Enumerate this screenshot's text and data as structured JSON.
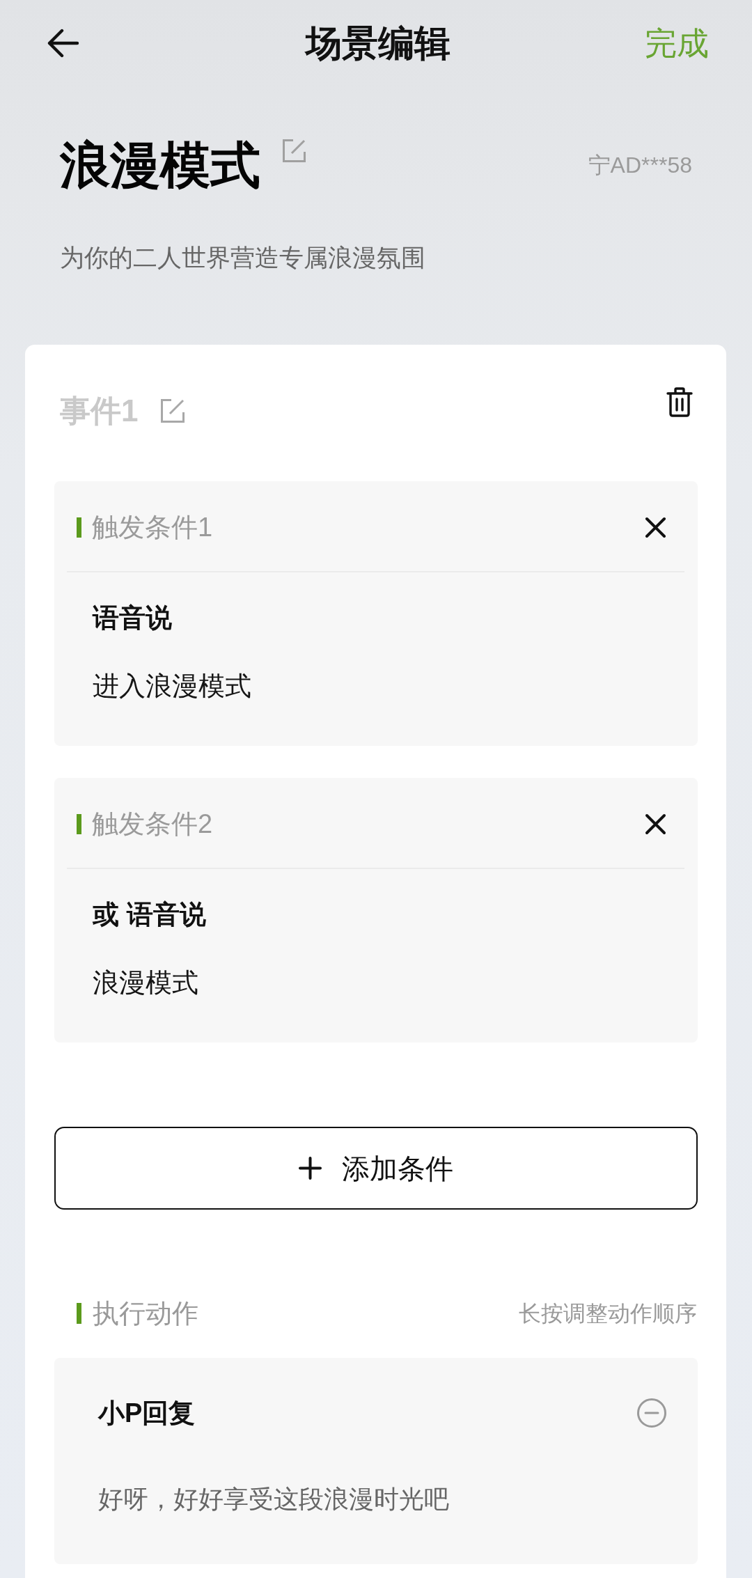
{
  "header": {
    "title": "场景编辑",
    "done": "完成"
  },
  "scene": {
    "name": "浪漫模式",
    "plate": "宁AD***58",
    "description": "为你的二人世界营造专属浪漫氛围"
  },
  "event": {
    "title": "事件1",
    "conditions": [
      {
        "label": "触发条件1",
        "heading": "语音说",
        "phrase": "进入浪漫模式"
      },
      {
        "label": "触发条件2",
        "heading": "或 语音说",
        "phrase": "浪漫模式"
      }
    ],
    "add_condition": "添加条件",
    "actions_header": {
      "title": "执行动作",
      "hint": "长按调整动作顺序"
    },
    "actions": [
      {
        "title": "小P回复",
        "text": "好呀，好好享受这段浪漫时光吧"
      }
    ]
  }
}
